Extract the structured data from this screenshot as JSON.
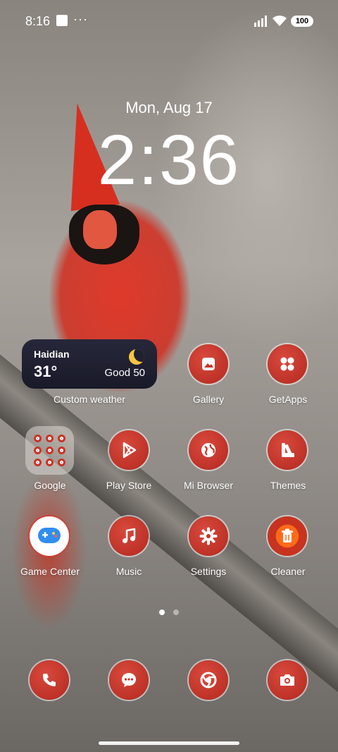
{
  "status_bar": {
    "time": "8:16",
    "dots": "···",
    "battery": "100"
  },
  "lock": {
    "date": "Mon, Aug 17",
    "time": "2:36"
  },
  "weather": {
    "city": "Haidian",
    "temp": "31°",
    "aqi": "Good 50",
    "label": "Custom weather"
  },
  "apps": {
    "gallery": "Gallery",
    "getapps": "GetApps",
    "google": "Google",
    "playstore": "Play Store",
    "mibrowser": "Mi Browser",
    "themes": "Themes",
    "gamecenter": "Game Center",
    "music": "Music",
    "settings": "Settings",
    "cleaner": "Cleaner"
  },
  "dock": [
    "phone-icon",
    "messages-icon",
    "chrome-icon",
    "camera-icon"
  ],
  "pager": {
    "pages": 2,
    "current": 1
  },
  "colors": {
    "icon_red": "#c73326",
    "widget_bg": "#1f2030",
    "accent_orange": "#ff6a1a"
  }
}
